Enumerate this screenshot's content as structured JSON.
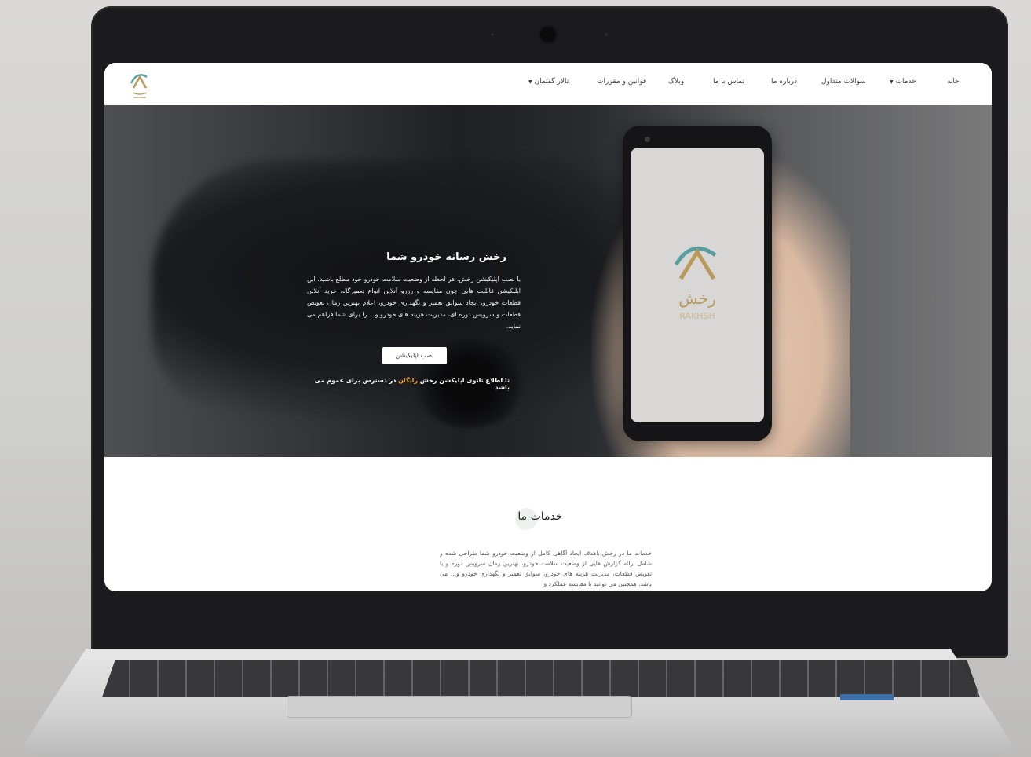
{
  "nav": {
    "items": [
      "خانه",
      "خدمات",
      "سوالات متداول",
      "درباره ما",
      "تماس با ما",
      "وبلاگ",
      "قوانین و مقررات",
      "تالار گفتمان"
    ]
  },
  "hero": {
    "title": "رخش رسانه خودرو شما",
    "text": "با نصب اپلیکیشن رخش، هر لحظه از وضعیت سلامت خودرو خود مطلع باشید. این اپلیکیشن قابلیت هایی چون مقایسه و رزرو آنلاین انواع تعمیرگاه، خرید آنلاین قطعات خودرو، ایجاد سوابق تعمیر و نگهداری خودرو، اعلام بهترین زمان تعویض قطعات و سرویس دوره ای، مدیریت هزینه های خودرو و... را برای شما فراهم می نماید.",
    "button": "نصب اپلیکیشن",
    "note_before": "تا اطلاع ثانوی اپلیکشن رخش ",
    "note_highlight": "رایگان",
    "note_after": " در دسترس برای عموم می باشد"
  },
  "phone": {
    "logo_text": "رخش",
    "logo_latin": "RAKHSH"
  },
  "services": {
    "title": "خدمات ما",
    "text": "خدمات ما در رخش باهدف ایجاد آگاهی کامل از وضعیت خودرو شما طراحی شده و شامل ارائه گزارش هایی از وضعیت سلامت خودرو، بهترین زمان سرویس دوره و یا تعویض قطعات، مدیریت هزینه های خودرو، سوابق تعمیر و نگهداری خودرو و... می باشد. همچنین می توانید با مقایسه عملکرد و"
  },
  "colors": {
    "accent": "#f0a332",
    "logo_gold": "#b89a5a",
    "logo_teal": "#5a9fa0"
  }
}
